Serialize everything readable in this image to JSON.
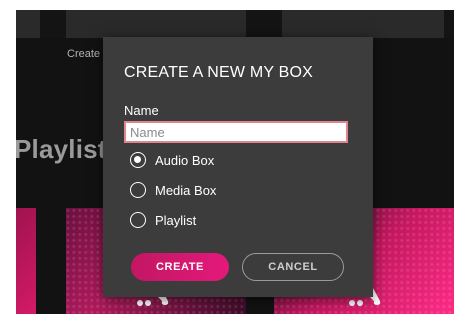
{
  "background": {
    "create_link": "Create",
    "heading": "Playlist"
  },
  "modal": {
    "title": "CREATE A NEW MY BOX",
    "name_label": "Name",
    "name_placeholder": "Name",
    "name_value": "",
    "options": [
      {
        "label": "Audio Box",
        "selected": true
      },
      {
        "label": "Media Box",
        "selected": false
      },
      {
        "label": "Playlist",
        "selected": false
      }
    ],
    "create_label": "CREATE",
    "cancel_label": "CANCEL"
  },
  "colors": {
    "accent": "#e4197a",
    "modal_bg": "#3c3c3c",
    "app_bg": "#121212"
  },
  "icons": [
    "playlist-card-icon"
  ]
}
